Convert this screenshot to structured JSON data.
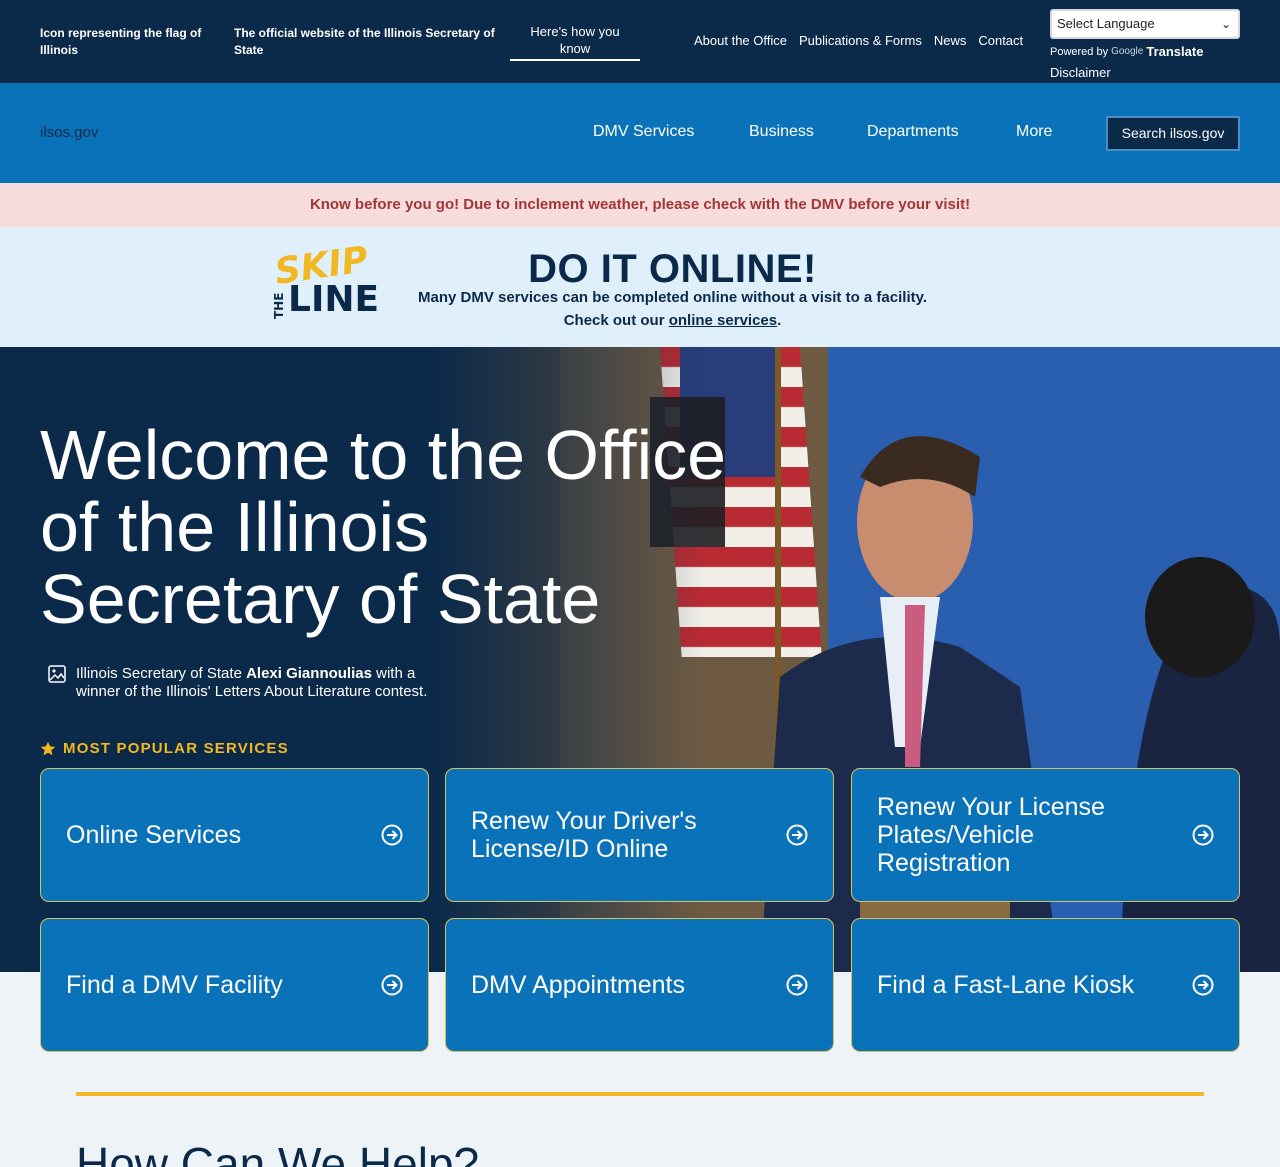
{
  "topbar": {
    "flag_text": "Icon representing the flag of Illinois",
    "official_text": "The official website of the Illinois Secretary of State",
    "how_know": "Here's how you know",
    "links": [
      "About the Office",
      "Publications & Forms",
      "News",
      "Contact"
    ],
    "language_select": "Select Language",
    "powered_by": "Powered by",
    "google": "Google",
    "translate": "Translate",
    "disclaimer": "Disclaimer"
  },
  "nav": {
    "logo_text": "ilsos.gov",
    "items": [
      "DMV Services",
      "Business",
      "Departments",
      "More"
    ],
    "search_label": "Search ilsos.gov"
  },
  "alert": "Know before you go! Due to inclement weather, please check with the DMV before your visit!",
  "skip": {
    "logo_skip": "SKIP",
    "logo_the": "THE",
    "logo_line": "LINE",
    "title": "DO IT ONLINE!",
    "line1": "Many DMV services can be completed online without a visit to a facility.",
    "line2_prefix": "Check out our ",
    "line2_link": "online services",
    "line2_suffix": "."
  },
  "hero": {
    "title": "Welcome to the Office of the Illinois Secretary of State",
    "caption_prefix": "Illinois Secretary of State ",
    "caption_name": "Alexi Giannoulias",
    "caption_suffix": " with a winner of the Illinois' Letters About Literature contest.",
    "popular_label": "MOST POPULAR SERVICES"
  },
  "services": [
    "Online Services",
    "Renew Your Driver's License/ID Online",
    "Renew Your License Plates/Vehicle Registration",
    "Find a DMV Facility",
    "DMV Appointments",
    "Find a Fast-Lane Kiosk"
  ],
  "help_heading": "How Can We Help?",
  "colors": {
    "navy": "#0b2a4a",
    "blue": "#0a72b9",
    "gold": "#f2b823",
    "alert_bg": "#f7dcdc",
    "alert_text": "#a33636",
    "skip_bg": "#dff0fb"
  },
  "icons": [
    "chevron-down-icon",
    "image-icon",
    "star-icon",
    "arrow-circle-right-icon"
  ]
}
